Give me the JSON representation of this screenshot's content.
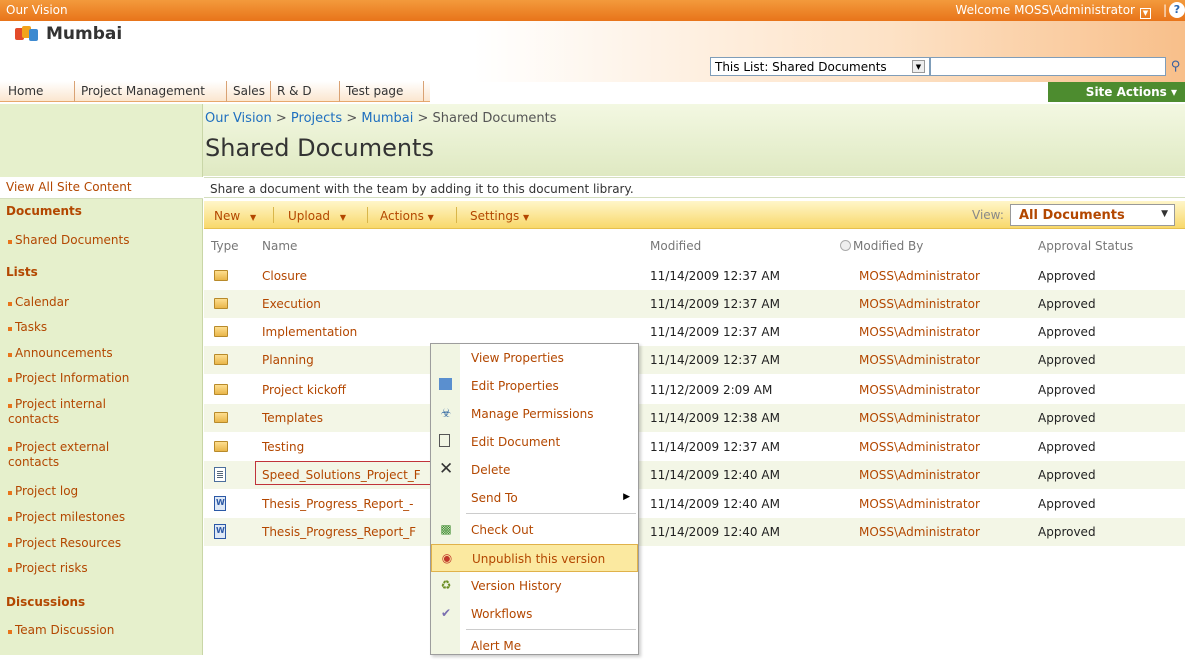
{
  "topbar": {
    "site": "Our Vision",
    "welcome": "Welcome MOSS\\Administrator",
    "separator": "|",
    "help": "?"
  },
  "header": {
    "site_title": "Mumbai",
    "scope": "This List: Shared Documents",
    "search_placeholder": ""
  },
  "nav": {
    "tabs": [
      "Home",
      "Project Management",
      "Sales",
      "R & D",
      "Test page"
    ]
  },
  "site_actions": "Site Actions ▾",
  "breadcrumb": {
    "a": "Our Vision",
    "sep": " > ",
    "b": "Projects",
    "c": "Mumbai",
    "d": "Shared Documents"
  },
  "page_title": "Shared Documents",
  "left": {
    "view_all": "View All Site Content",
    "documents_header": "Documents",
    "documents": [
      "Shared Documents"
    ],
    "lists_header": "Lists",
    "lists": [
      "Calendar",
      "Tasks",
      "Announcements",
      "Project Information",
      "Project internal contacts",
      "Project external contacts",
      "Project log",
      "Project milestones",
      "Project Resources",
      "Project risks"
    ],
    "discussions_header": "Discussions",
    "discussions": [
      "Team Discussion"
    ]
  },
  "description": "Share a document with the team by adding it to this document library.",
  "toolbar": {
    "new": "New",
    "upload": "Upload",
    "actions": "Actions",
    "settings": "Settings",
    "view_label": "View:",
    "view_value": "All Documents"
  },
  "columns": {
    "type": "Type",
    "name": "Name",
    "modified": "Modified",
    "modified_by": "Modified By",
    "approval": "Approval Status"
  },
  "rows": [
    {
      "type": "folder",
      "name": "Closure",
      "modified": "11/14/2009 12:37 AM",
      "by": "MOSS\\Administrator",
      "status": "Approved"
    },
    {
      "type": "folder",
      "name": "Execution",
      "modified": "11/14/2009 12:37 AM",
      "by": "MOSS\\Administrator",
      "status": "Approved"
    },
    {
      "type": "folder",
      "name": "Implementation",
      "modified": "11/14/2009 12:37 AM",
      "by": "MOSS\\Administrator",
      "status": "Approved"
    },
    {
      "type": "folder",
      "name": "Planning",
      "modified": "11/14/2009 12:37 AM",
      "by": "MOSS\\Administrator",
      "status": "Approved"
    },
    {
      "type": "folder",
      "name": "Project kickoff",
      "modified": "11/12/2009 2:09 AM",
      "by": "MOSS\\Administrator",
      "status": "Approved"
    },
    {
      "type": "folder",
      "name": "Templates",
      "modified": "11/14/2009 12:38 AM",
      "by": "MOSS\\Administrator",
      "status": "Approved"
    },
    {
      "type": "folder",
      "name": "Testing",
      "modified": "11/14/2009 12:37 AM",
      "by": "MOSS\\Administrator",
      "status": "Approved"
    },
    {
      "type": "doc",
      "name": "Speed_Solutions_Project_F",
      "modified": "11/14/2009 12:40 AM",
      "by": "MOSS\\Administrator",
      "status": "Approved"
    },
    {
      "type": "word",
      "name": "Thesis_Progress_Report_-",
      "modified": "11/14/2009 12:40 AM",
      "by": "MOSS\\Administrator",
      "status": "Approved"
    },
    {
      "type": "word",
      "name": "Thesis_Progress_Report_F",
      "modified": "11/14/2009 12:40 AM",
      "by": "MOSS\\Administrator",
      "status": "Approved"
    }
  ],
  "context_menu": [
    "View Properties",
    "Edit Properties",
    "Manage Permissions",
    "Edit Document",
    "Delete",
    "Send To",
    "Check Out",
    "Unpublish this version",
    "Version History",
    "Workflows",
    "Alert Me"
  ],
  "colors": {
    "orange": "#e8741a",
    "link": "#b34700",
    "green": "#4d8c2f"
  }
}
